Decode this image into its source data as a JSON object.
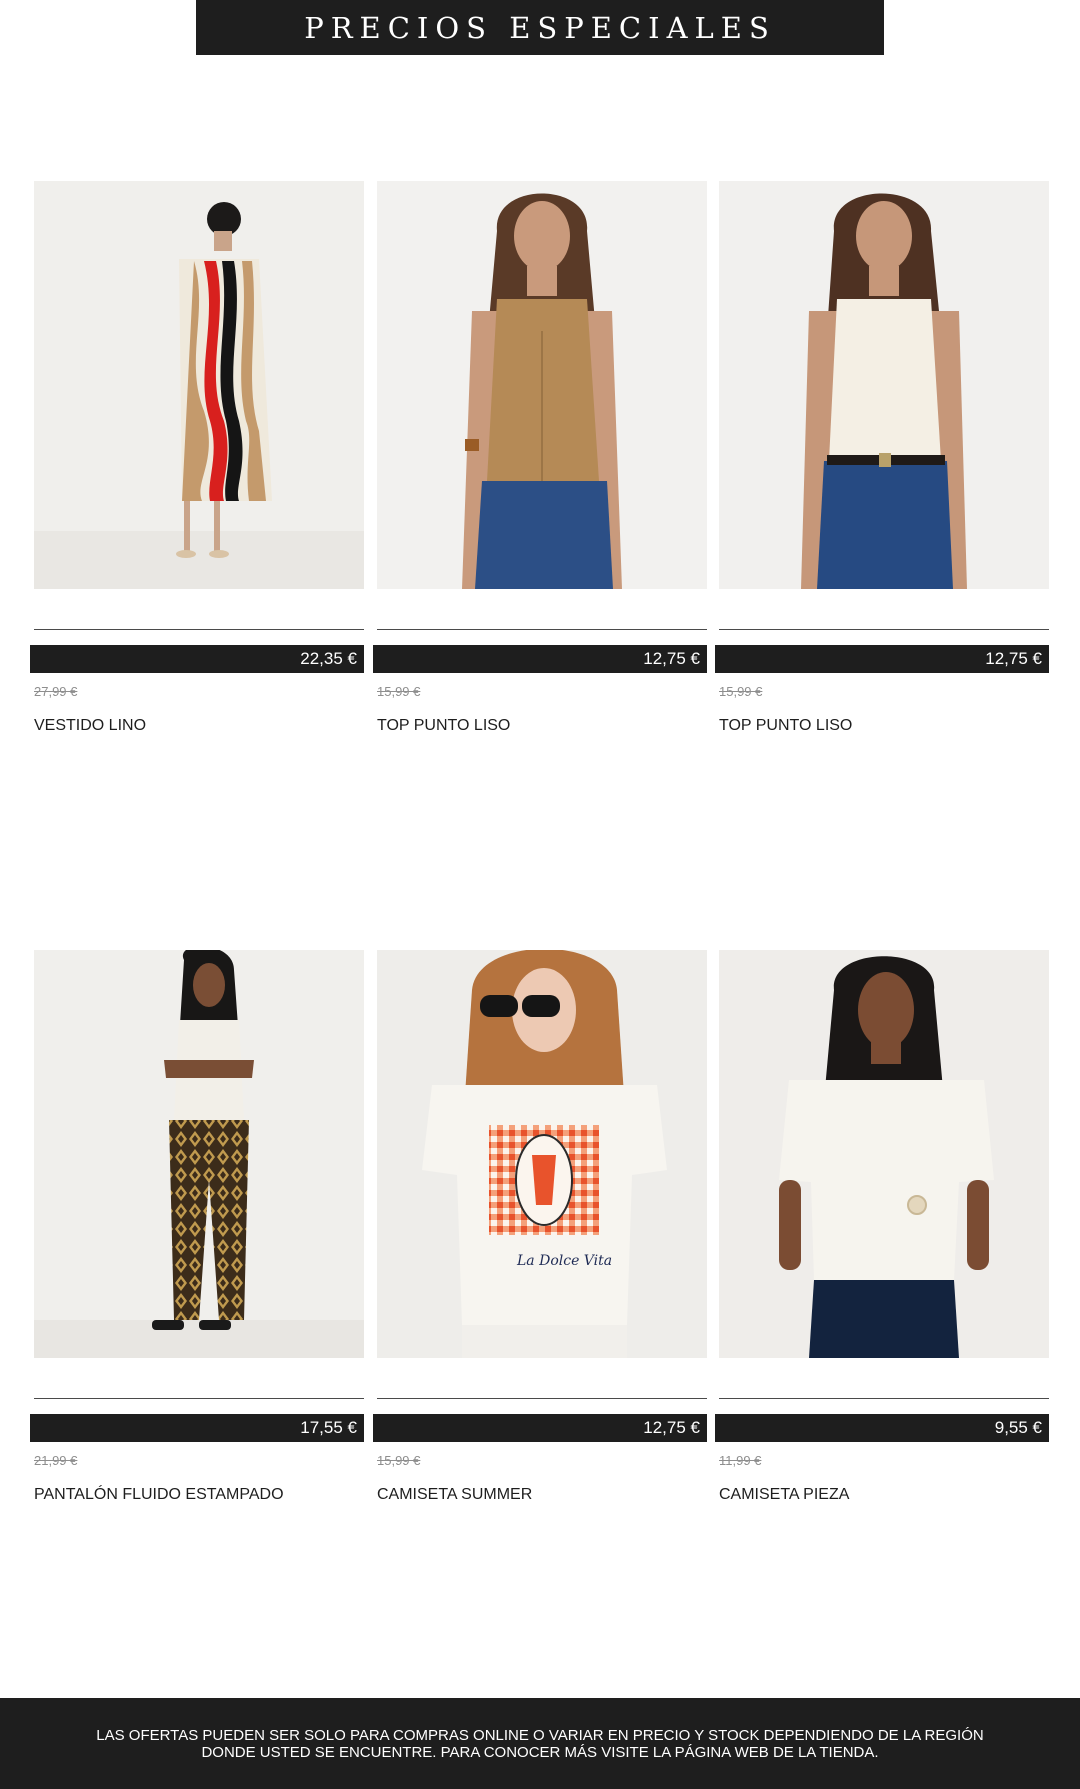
{
  "banner": {
    "title": "PRECIOS ESPECIALES"
  },
  "products": [
    {
      "name": "VESTIDO LINO",
      "price": "22,35 €",
      "old_price": "27,99 €",
      "image": "model in long wave-striped linen dress"
    },
    {
      "name": "TOP PUNTO LISO",
      "price": "12,75 €",
      "old_price": "15,99 €",
      "image": "model in camel knit top and jeans"
    },
    {
      "name": "TOP PUNTO LISO",
      "price": "12,75 €",
      "old_price": "15,99 €",
      "image": "model in cream knit top and jeans"
    },
    {
      "name": "PANTALÓN FLUIDO ESTAMPADO",
      "price": "17,55 €",
      "old_price": "21,99 €",
      "image": "model in printed fluid trousers"
    },
    {
      "name": "CAMISETA SUMMER",
      "price": "12,75 €",
      "old_price": "15,99 €",
      "image": "model in white tee with lobster print"
    },
    {
      "name": "CAMISETA PIEZA",
      "price": "9,55 €",
      "old_price": "11,99 €",
      "image": "model in white tee with knot detail"
    }
  ],
  "footer": {
    "disclaimer": "LAS OFERTAS PUEDEN SER SOLO PARA COMPRAS ONLINE O VARIAR EN PRECIO Y STOCK DEPENDIENDO DE LA REGIÓN DONDE USTED SE ENCUENTRE. PARA CONOCER MÁS VISITE LA PÁGINA WEB DE LA TIENDA."
  },
  "colors": {
    "dark": "#1e1e1e",
    "old_price": "#8e8e8e",
    "background": "#ffffff"
  }
}
